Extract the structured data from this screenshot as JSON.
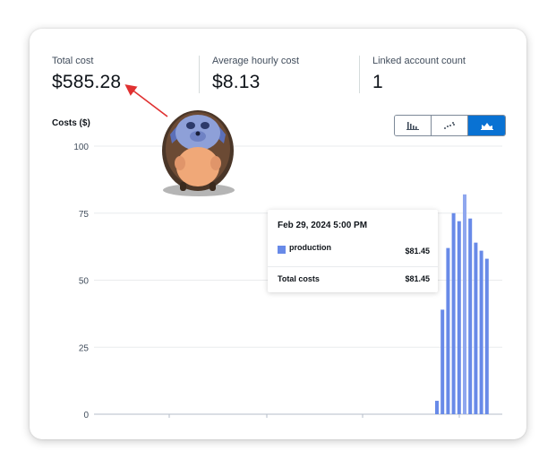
{
  "metrics": [
    {
      "label": "Total cost",
      "value": "$585.28"
    },
    {
      "label": "Average hourly cost",
      "value": "$8.13"
    },
    {
      "label": "Linked account count",
      "value": "1"
    }
  ],
  "chart_controls": {
    "options": [
      "bar-chart-icon",
      "scatter-chart-icon",
      "area-chart-icon"
    ],
    "selected": "area-chart-icon"
  },
  "chart_data": {
    "type": "bar",
    "title": "Costs ($)",
    "ylim": [
      0,
      100
    ],
    "yticks": [
      "100",
      "75",
      "50",
      "25",
      "0"
    ],
    "grid": true,
    "series": [
      {
        "name": "production",
        "color": "#688ae8",
        "values": [
          5,
          39,
          62,
          75,
          72,
          82,
          73,
          64,
          61,
          58
        ],
        "highlight_index": 5
      }
    ]
  },
  "tooltip": {
    "header": "Feb 29, 2024 5:00 PM",
    "series_label": "production",
    "series_value": "$81.45",
    "total_label": "Total costs",
    "total_value": "$81.45"
  },
  "annotation": {
    "arrow_color": "#e03131"
  }
}
